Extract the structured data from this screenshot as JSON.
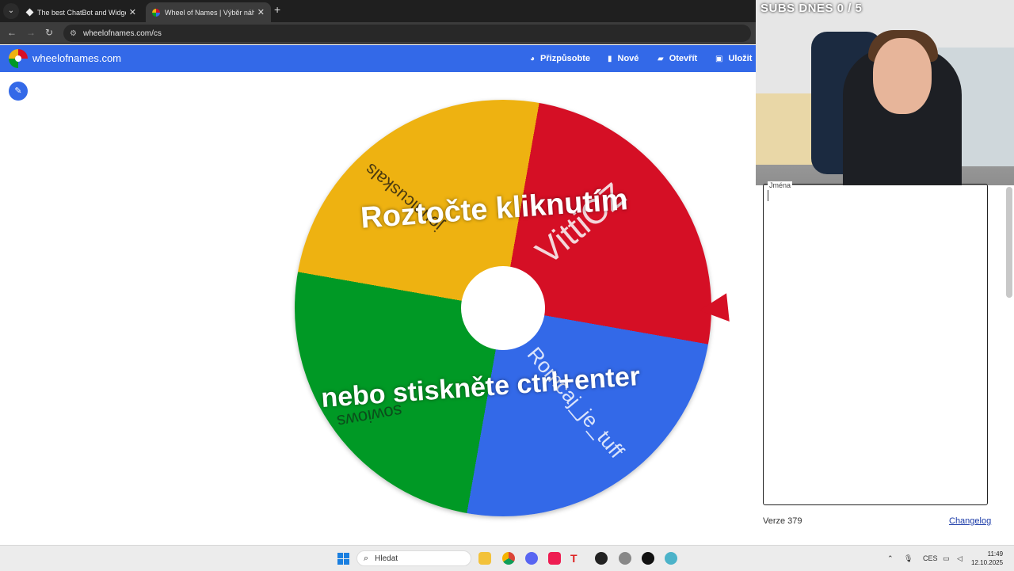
{
  "browser": {
    "tabs": [
      {
        "title": "The best ChatBot and Widgets"
      },
      {
        "title": "Wheel of Names | Výběr náhod"
      }
    ],
    "address": "wheelofnames.com/cs"
  },
  "app": {
    "brand": "wheelofnames.com",
    "menu": {
      "customize": "Přizpůsobte",
      "new": "Nové",
      "open": "Otevřít",
      "save": "Uložit"
    }
  },
  "wheel": {
    "segments": [
      {
        "name": "VittiCZ",
        "color": "#d50f25"
      },
      {
        "name": "Romcaj_je_tuff",
        "color": "#3369e8"
      },
      {
        "name": "sowiows",
        "color": "#009925"
      },
      {
        "name": "jounicuskals",
        "color": "#eeb211"
      }
    ],
    "hint_line1": "Roztočte kliknutím",
    "hint_line2": "nebo stiskněte ctrl+enter",
    "pointer_color": "#d50f25"
  },
  "overlay": {
    "subs": "SUBS DNES  0 / 5"
  },
  "panel": {
    "entries_label": "Jména",
    "version": "Verze 379",
    "changelog": "Changelog"
  },
  "taskbar": {
    "search_placeholder": "Hledat",
    "language": "CES",
    "time": "11:49",
    "date": "12.10.2025"
  }
}
